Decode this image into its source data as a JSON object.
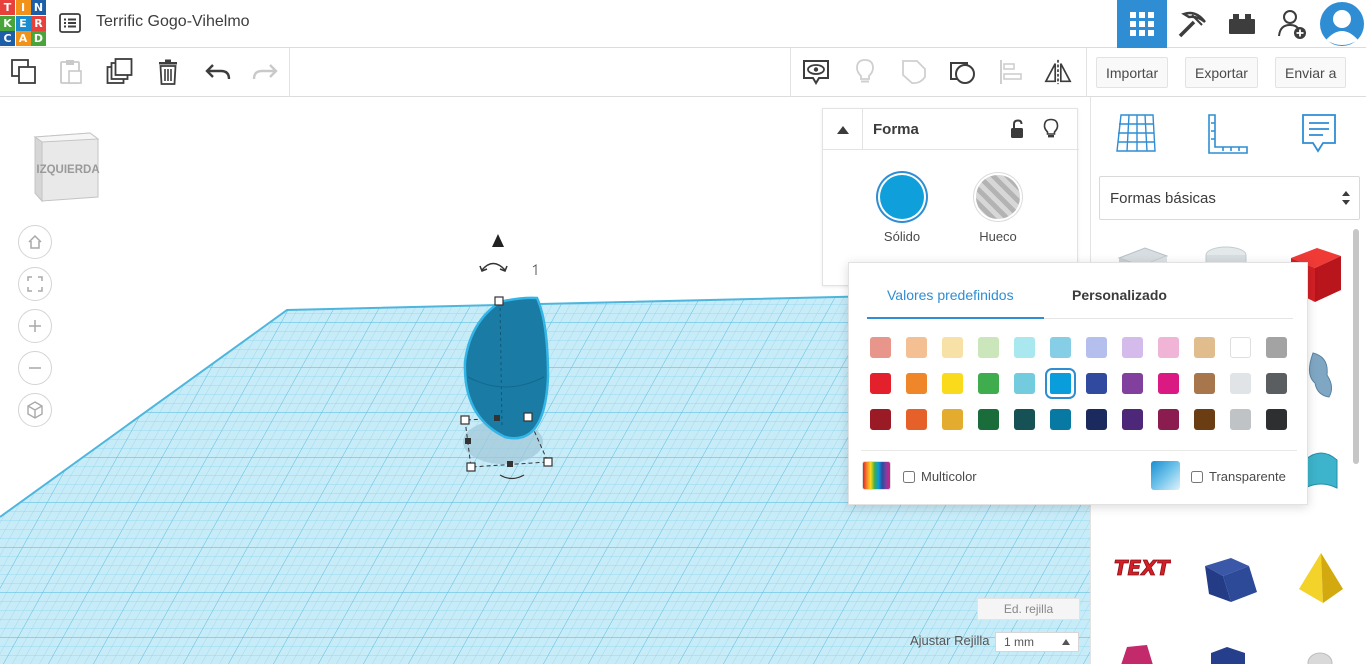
{
  "header": {
    "logo_letters": [
      "T",
      "I",
      "N",
      "K",
      "E",
      "R",
      "C",
      "A",
      "D"
    ],
    "title": "Terrific Gogo-Vihelmo",
    "icons": [
      "design-list-icon",
      "grid-view-icon",
      "pickaxe-icon",
      "bricks-icon",
      "add-user-icon",
      "avatar-icon"
    ]
  },
  "toolbar": {
    "icons": [
      "copy-icon",
      "paste-icon",
      "duplicate-icon",
      "delete-icon",
      "undo-icon",
      "redo-icon",
      "note-icon",
      "light-icon",
      "group-icon",
      "ungroup-icon",
      "align-icon",
      "mirror-icon"
    ],
    "import_label": "Importar",
    "export_label": "Exportar",
    "send_label": "Enviar a"
  },
  "viewcube": {
    "face_label": "IZQUIERDA"
  },
  "nav_controls": [
    "home-icon",
    "fit-view-icon",
    "zoom-in-icon",
    "zoom-out-icon",
    "ortho-view-icon"
  ],
  "inspector": {
    "title": "Forma",
    "solid_label": "Sólido",
    "hole_label": "Hueco",
    "solid_color": "#0f9fdb"
  },
  "color_popup": {
    "tab_presets": "Valores predefinidos",
    "tab_custom": "Personalizado",
    "selected_color": "#0a9ddb",
    "swatches": [
      [
        "#e8968b",
        "#f5bf94",
        "#f7e1a6",
        "#cce6bb",
        "#a9e8ef",
        "#86cde6",
        "#b5bfee",
        "#d5baec",
        "#f0b4d7",
        "#e1bd8e",
        "#ffffff",
        "#a3a3a3"
      ],
      [
        "#e4202c",
        "#f0862a",
        "#fadb1b",
        "#3fad4d",
        "#73ccde",
        "#0a9ddb",
        "#2f4a9f",
        "#813f9e",
        "#db1983",
        "#a7764c",
        "#e1e4e6",
        "#5b5e61"
      ],
      [
        "#9a1a26",
        "#e6602a",
        "#e3ac2e",
        "#1a6d3a",
        "#165156",
        "#0779a3",
        "#1a2a5e",
        "#4d2778",
        "#8a1c4f",
        "#6b3d12",
        "#bfc3c6",
        "#2d2f31"
      ]
    ],
    "multicolor_label": "Multicolor",
    "transparent_label": "Transparente"
  },
  "right_panel": {
    "category_label": "Formas básicas",
    "top_icons": [
      "workplane-icon",
      "ruler-icon",
      "notes-icon"
    ]
  },
  "bottom": {
    "edit_grid_label": "Ed. rejilla",
    "snap_label": "Ajustar Rejilla",
    "snap_value": "1 mm"
  }
}
